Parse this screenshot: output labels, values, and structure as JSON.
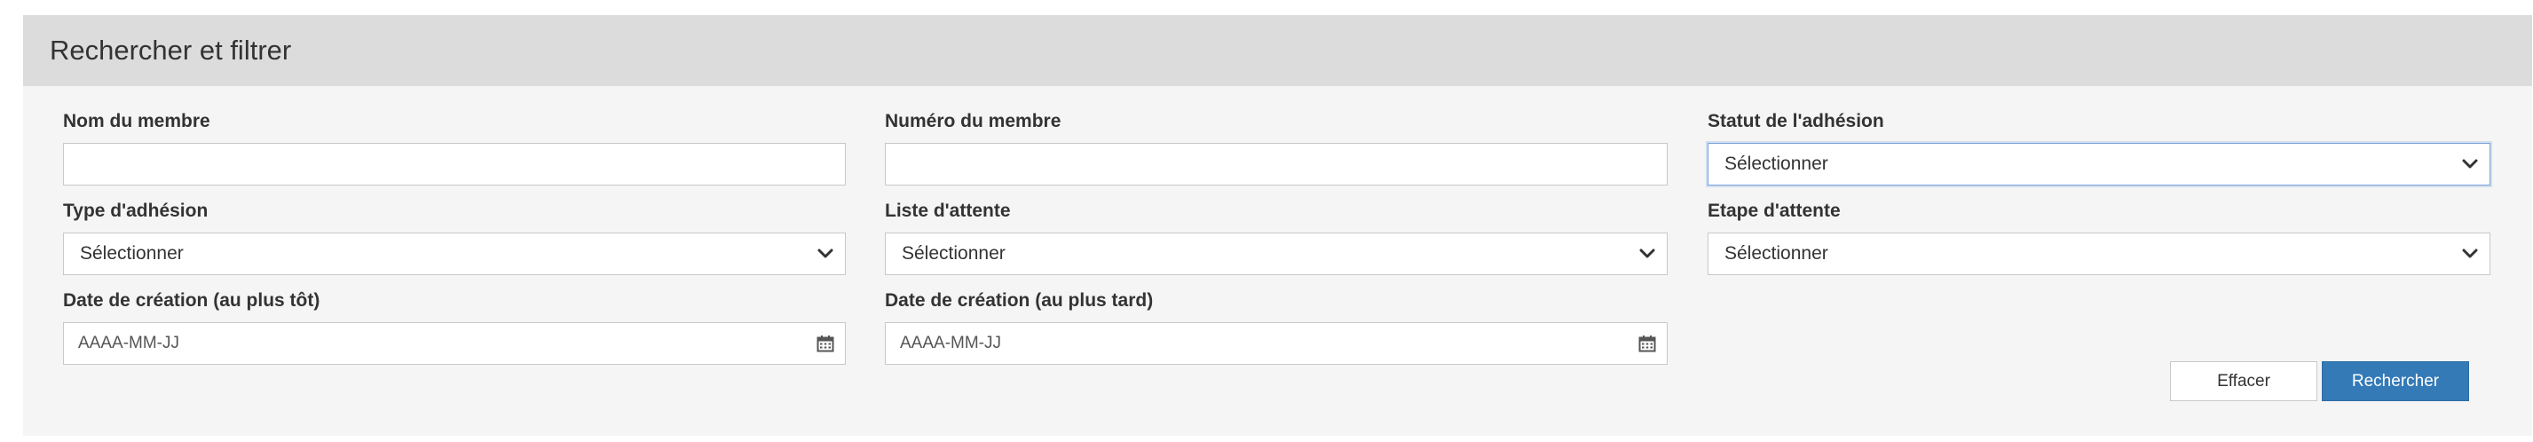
{
  "panel": {
    "title": "Rechercher et filtrer"
  },
  "fields": {
    "member_name": {
      "label": "Nom du membre",
      "value": ""
    },
    "member_number": {
      "label": "Numéro du membre",
      "value": ""
    },
    "membership_status": {
      "label": "Statut de l'adhésion",
      "value": "Sélectionner"
    },
    "membership_type": {
      "label": "Type d'adhésion",
      "value": "Sélectionner"
    },
    "waiting_list": {
      "label": "Liste d'attente",
      "value": "Sélectionner"
    },
    "waiting_stage": {
      "label": "Etape d'attente",
      "value": "Sélectionner"
    },
    "created_earliest": {
      "label": "Date de création (au plus tôt)",
      "placeholder": "AAAA-MM-JJ"
    },
    "created_latest": {
      "label": "Date de création (au plus tard)",
      "placeholder": "AAAA-MM-JJ"
    }
  },
  "buttons": {
    "clear_label": "Effacer",
    "search_label": "Rechercher"
  },
  "icons": {
    "select_arrow": "chevron-down-icon",
    "date_picker": "calendar-icon"
  },
  "colors": {
    "primary_button": "#337ab7",
    "panel_header_bg": "#dcdcdc",
    "panel_bg": "#f5f5f5"
  }
}
